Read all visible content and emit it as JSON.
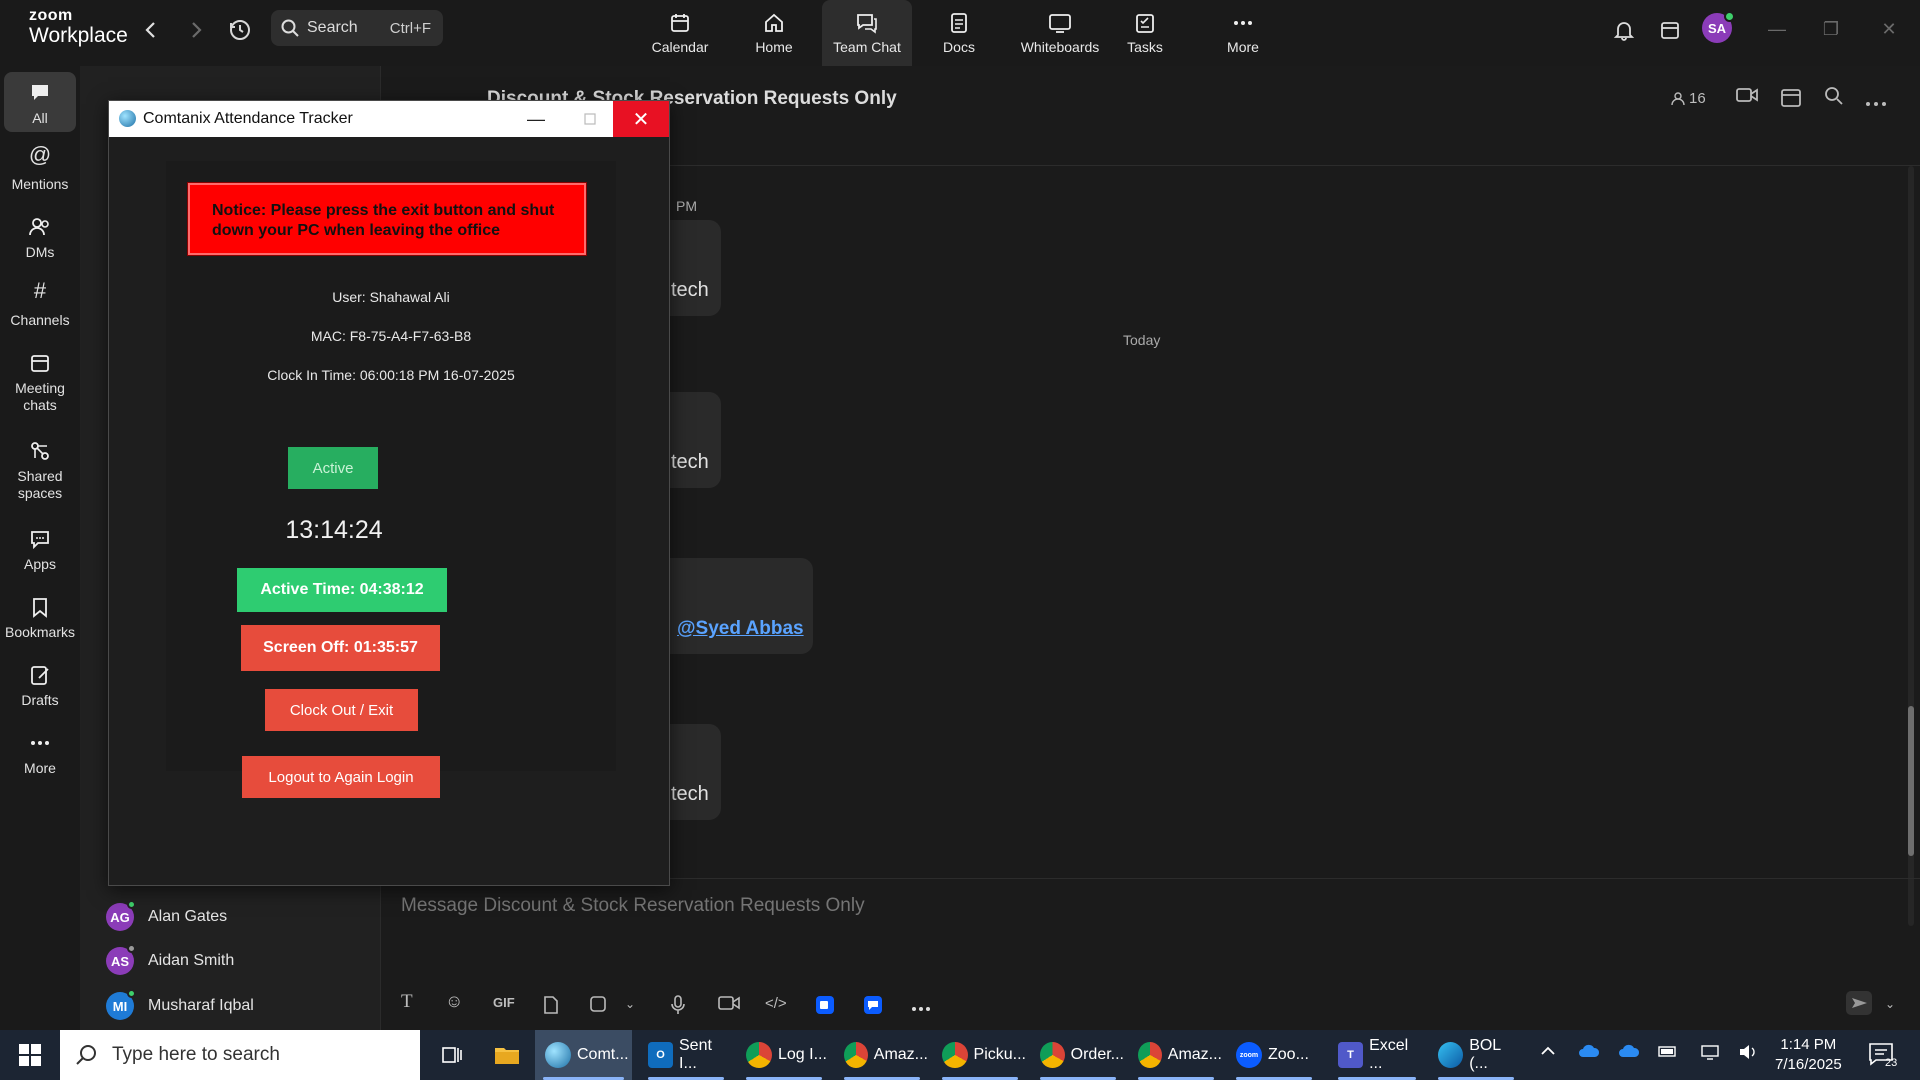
{
  "app": {
    "logo_line1": "zoom",
    "logo_line2": "Workplace",
    "search_label": "Search",
    "search_shortcut": "Ctrl+F",
    "nav": [
      {
        "label": "Calendar",
        "icon": "calendar-icon"
      },
      {
        "label": "Home",
        "icon": "home-icon"
      },
      {
        "label": "Team Chat",
        "icon": "chat-icon",
        "active": true
      },
      {
        "label": "Docs",
        "icon": "docs-icon"
      },
      {
        "label": "Whiteboards",
        "icon": "whiteboard-icon"
      },
      {
        "label": "Tasks",
        "icon": "tasks-icon"
      },
      {
        "label": "More",
        "icon": "more-icon"
      }
    ],
    "user_initials": "SA",
    "accent": "#0e72ed"
  },
  "rail": {
    "items": [
      {
        "label": "All",
        "icon": "chat-bubble-icon",
        "active": true
      },
      {
        "label": "Mentions",
        "icon": "at-icon"
      },
      {
        "label": "DMs",
        "icon": "people-icon"
      },
      {
        "label": "Channels",
        "icon": "hash-icon"
      },
      {
        "label": "Meeting chats",
        "icon": "calendar-icon"
      },
      {
        "label": "Shared spaces",
        "icon": "shared-spaces-icon"
      },
      {
        "label": "Apps",
        "icon": "apps-icon"
      },
      {
        "label": "Bookmarks",
        "icon": "bookmark-icon"
      },
      {
        "label": "Drafts",
        "icon": "drafts-icon"
      },
      {
        "label": "More",
        "icon": "more-icon"
      }
    ]
  },
  "chatlist": {
    "contacts": [
      {
        "initials": "AG",
        "name": "Alan Gates",
        "color": "#8b3cb8"
      },
      {
        "initials": "AS",
        "name": "Aidan Smith",
        "color": "#8b3cb8"
      },
      {
        "initials": "MI",
        "name": "Musharaf Iqbal",
        "color": "#1f7bd6"
      }
    ]
  },
  "chat": {
    "title": "Discount & Stock Reservation Requests Only",
    "member_count": "16",
    "time_label": "PM",
    "today_label": "Today",
    "msg1": "tech",
    "msg2": "tech",
    "msg3": "tech",
    "mention": "@Syed Abbas",
    "composer_placeholder": "Message Discount & Stock Reservation Requests Only"
  },
  "dialog": {
    "title": "Comtanix Attendance Tracker",
    "notice": "Notice: Please press the exit button and shut down your PC when leaving the office",
    "user": "User: Shahawal Ali",
    "mac": "MAC: F8-75-A4-F7-63-B8",
    "clock_in": "Clock In Time: 06:00:18 PM 16-07-2025",
    "status": "Active",
    "clock": "13:14:24",
    "active_time": "Active Time: 04:38:12",
    "screen_off": "Screen Off: 01:35:57",
    "clock_out_label": "Clock Out / Exit",
    "relogin_label": "Logout to Again Login"
  },
  "taskbar": {
    "search_placeholder": "Type here to search",
    "apps": [
      {
        "label": "Comt...",
        "icon": "tracker-icon",
        "color": "#2a9fd8",
        "active": true
      },
      {
        "label": "Sent I...",
        "icon": "outlook-icon",
        "color": "#0f6cbd"
      },
      {
        "label": "Log I...",
        "icon": "chrome-icon",
        "color": "#db4437"
      },
      {
        "label": "Amaz...",
        "icon": "chrome-icon",
        "color": "#db4437"
      },
      {
        "label": "Picku...",
        "icon": "chrome-icon",
        "color": "#db4437"
      },
      {
        "label": "Order...",
        "icon": "chrome-icon",
        "color": "#db4437"
      },
      {
        "label": "Amaz...",
        "icon": "chrome-icon",
        "color": "#db4437"
      },
      {
        "label": "Zoo...",
        "icon": "zoom-icon",
        "color": "#0b5cff"
      },
      {
        "label": "Excel ...",
        "icon": "teams-icon",
        "color": "#5059c9"
      },
      {
        "label": "BOL (...",
        "icon": "edge-icon",
        "color": "#1b9de2"
      }
    ],
    "time": "1:14 PM",
    "date": "7/16/2025",
    "notification_count": "23"
  }
}
